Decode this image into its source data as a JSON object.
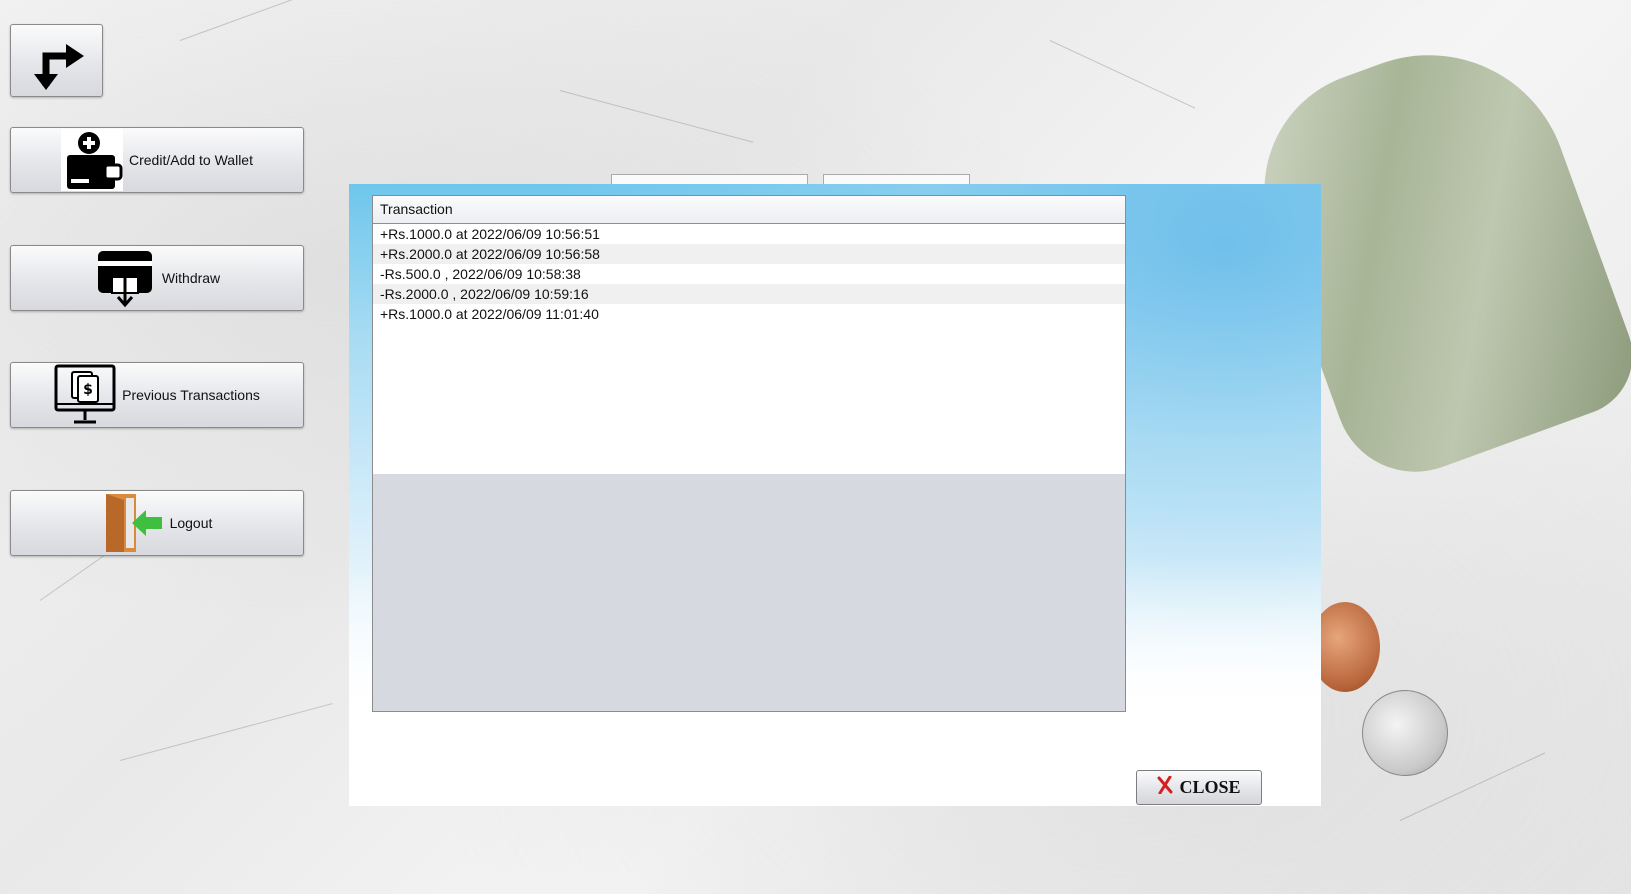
{
  "sidebar": {
    "switch_button": {
      "icon": "switch-arrows-icon"
    },
    "credit_label": "Credit/Add to Wallet",
    "withdraw_label": "Withdraw",
    "previous_label": "Previous Transactions",
    "logout_label": "Logout"
  },
  "dialog": {
    "column_header": "Transaction",
    "rows": [
      "+Rs.1000.0 at 2022/06/09 10:56:51",
      "+Rs.2000.0 at 2022/06/09 10:56:58",
      "-Rs.500.0 , 2022/06/09 10:58:38",
      "-Rs.2000.0 , 2022/06/09 10:59:16",
      "+Rs.1000.0 at 2022/06/09 11:01:40"
    ],
    "close_label": "CLOSE"
  },
  "colors": {
    "dialog_top": "#6ec6ec",
    "close_icon": "#d61f1f",
    "logout_arrow": "#3fbf3f",
    "door": "#d98a3a"
  }
}
